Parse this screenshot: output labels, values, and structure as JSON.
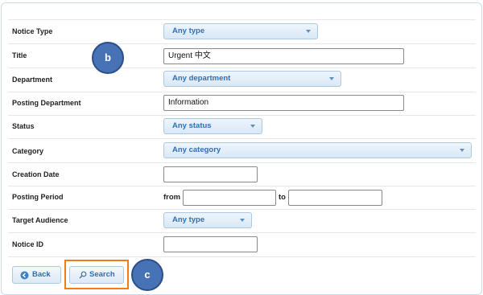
{
  "form": {
    "notice_type": {
      "label": "Notice Type",
      "value": "Any type"
    },
    "title": {
      "label": "Title",
      "value": "Urgent 中文"
    },
    "department": {
      "label": "Department",
      "value": "Any department"
    },
    "posting_department": {
      "label": "Posting Department",
      "value": "Information"
    },
    "status": {
      "label": "Status",
      "value": "Any status"
    },
    "category": {
      "label": "Category",
      "value": "Any category"
    },
    "creation_date": {
      "label": "Creation Date",
      "value": ""
    },
    "posting_period": {
      "label": "Posting Period",
      "from_label": "from",
      "to_label": "to",
      "from_value": "",
      "to_value": ""
    },
    "target_audience": {
      "label": "Target Audience",
      "value": "Any type"
    },
    "notice_id": {
      "label": "Notice ID",
      "value": ""
    }
  },
  "buttons": {
    "back": "Back",
    "search": "Search"
  },
  "annotations": {
    "b": "b",
    "c": "c"
  },
  "colors": {
    "accent": "#2f6fb0",
    "callout": "#4772b5",
    "highlight": "#f07c1a"
  }
}
